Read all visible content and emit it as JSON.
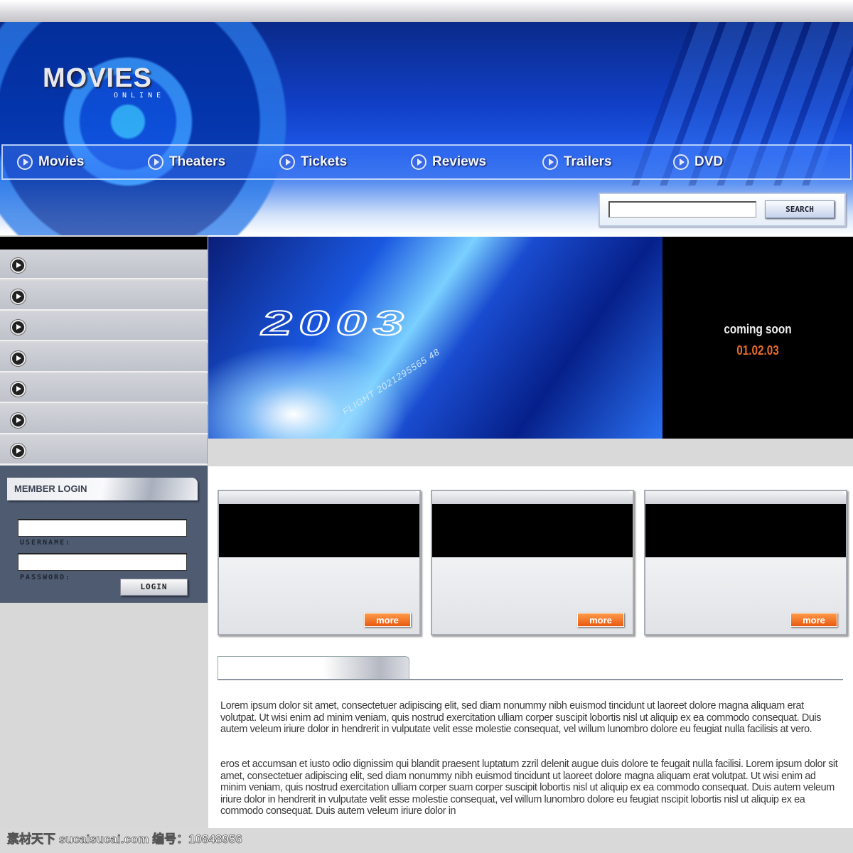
{
  "header": {
    "logo": "MOVIES",
    "logo_sub": "ONLINE",
    "nav": [
      {
        "label": "Movies"
      },
      {
        "label": "Theaters"
      },
      {
        "label": "Tickets"
      },
      {
        "label": "Reviews"
      },
      {
        "label": "Trailers"
      },
      {
        "label": "DVD"
      }
    ],
    "search": {
      "value": "",
      "button": "SEARCH"
    }
  },
  "sidebar": {
    "item_count": 7
  },
  "login": {
    "title": "MEMBER LOGIN",
    "username_label": "USERNAME:",
    "password_label": "PASSWORD:",
    "username_value": "",
    "password_value": "",
    "button": "LOGIN"
  },
  "banner": {
    "year": "2003",
    "code": "FLIGHT 2021295565 48",
    "coming": "coming soon",
    "date": "01.02.03"
  },
  "cards": [
    {
      "more": "more"
    },
    {
      "more": "more"
    },
    {
      "more": "more"
    }
  ],
  "content": {
    "paragraphs": [
      "Lorem ipsum dolor sit amet, consectetuer adipiscing elit, sed diam nonummy nibh euismod tincidunt ut laoreet dolore magna aliquam erat volutpat. Ut wisi enim ad minim veniam, quis nostrud exercitation ulliam corper suscipit lobortis nisl ut aliquip ex ea commodo consequat. Duis autem veleum iriure dolor in hendrerit in vulputate velit esse molestie consequat, vel willum lunombro dolore eu feugiat nulla facilisis at vero.",
      "eros et accumsan et iusto odio dignissim qui blandit praesent luptatum zzril delenit augue duis dolore te feugait nulla facilisi. Lorem ipsum dolor sit amet, consectetuer adipiscing elit, sed diam nonummy nibh euismod tincidunt ut laoreet dolore magna aliquam erat volutpat. Ut wisi enim ad minim veniam, quis nostrud exercitation ulliam corper suam corper suscipit lobortis nisl ut aliquip ex ea commodo consequat. Duis autem veleum iriure dolor in hendrerit in vulputate velit esse molestie consequat, vel willum lunombro dolore eu feugiat nscipit lobortis nisl ut aliquip ex ea commodo consequat. Duis autem veleum iriure dolor in"
    ]
  },
  "watermark": "素材天下 sucaisucai.com  编号：10848956",
  "colors": {
    "header_blue": "#1140c8",
    "login_panel": "#4e5b70",
    "accent_orange": "#e86a28"
  }
}
